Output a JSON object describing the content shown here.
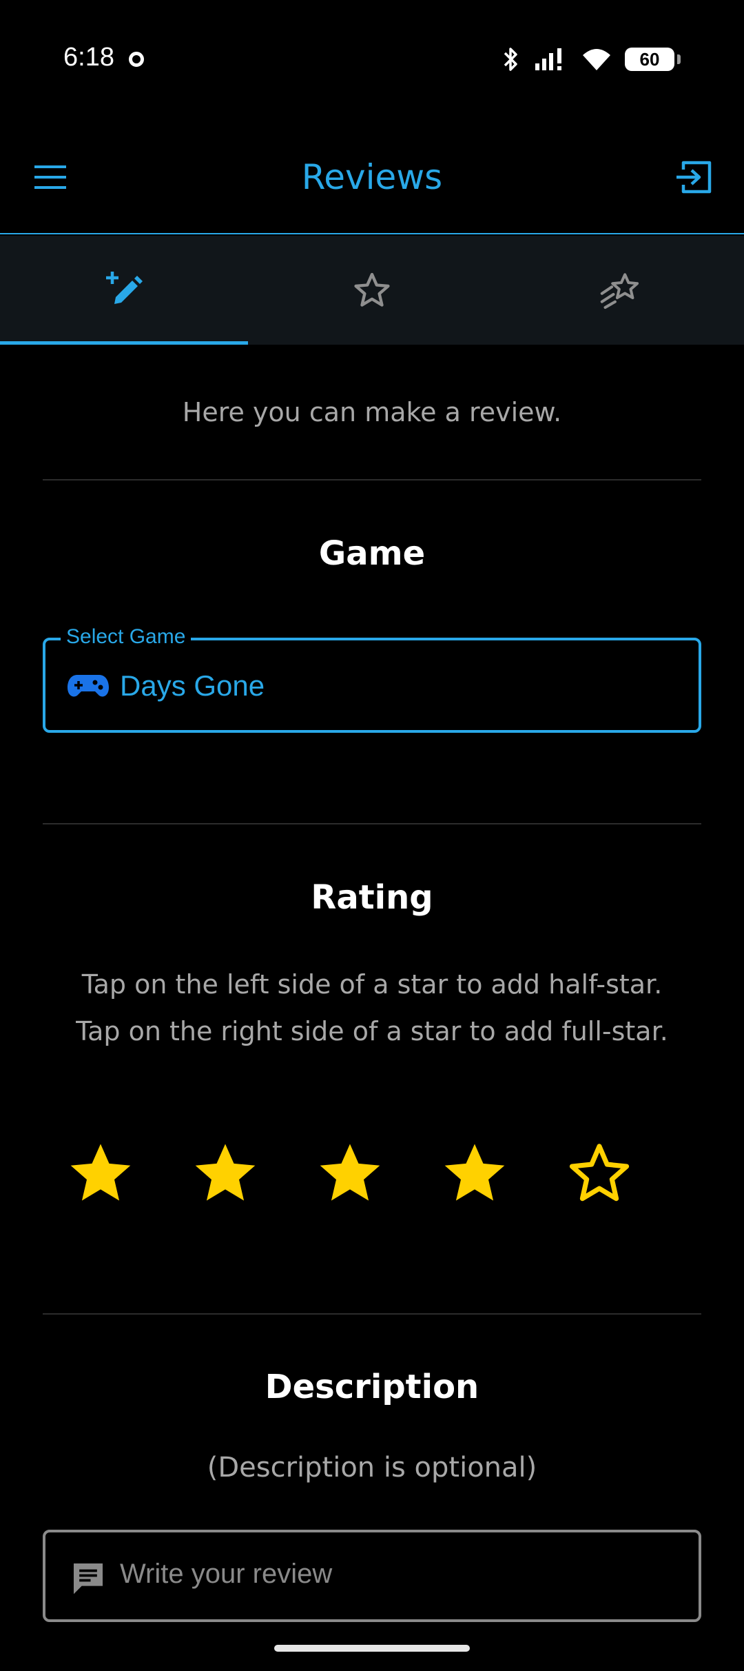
{
  "status_bar": {
    "time": "6:18",
    "battery": "60",
    "icons": [
      "bluetooth-icon",
      "signal-icon",
      "wifi-icon",
      "battery-icon"
    ]
  },
  "app_bar": {
    "title": "Reviews",
    "menu_icon": "menu-icon",
    "logout_icon": "logout-icon"
  },
  "tabs": [
    {
      "icon": "pencil-plus-icon",
      "selected": true
    },
    {
      "icon": "star-outline-icon",
      "selected": false
    },
    {
      "icon": "shooting-stars-icon",
      "selected": false
    }
  ],
  "main": {
    "intro": "Here you can make a review.",
    "game_section": {
      "title": "Game",
      "field_label": "Select Game",
      "field_value": "Days Gone",
      "field_icon": "gamepad-icon"
    },
    "rating_section": {
      "title": "Rating",
      "instruction_line1": "Tap on the left side of a star to add half-star.",
      "instruction_line2": "Tap on the right side of a star to add full-star.",
      "rating_value": 4,
      "rating_max": 5
    },
    "description_section": {
      "title": "Description",
      "note": "(Description is optional)",
      "placeholder": "Write your review",
      "icon": "comment-icon"
    }
  },
  "colors": {
    "accent": "#29a8e8",
    "star": "#ffd100",
    "muted_text": "#a8a8a8",
    "tab_bar_bg": "#11161a"
  }
}
